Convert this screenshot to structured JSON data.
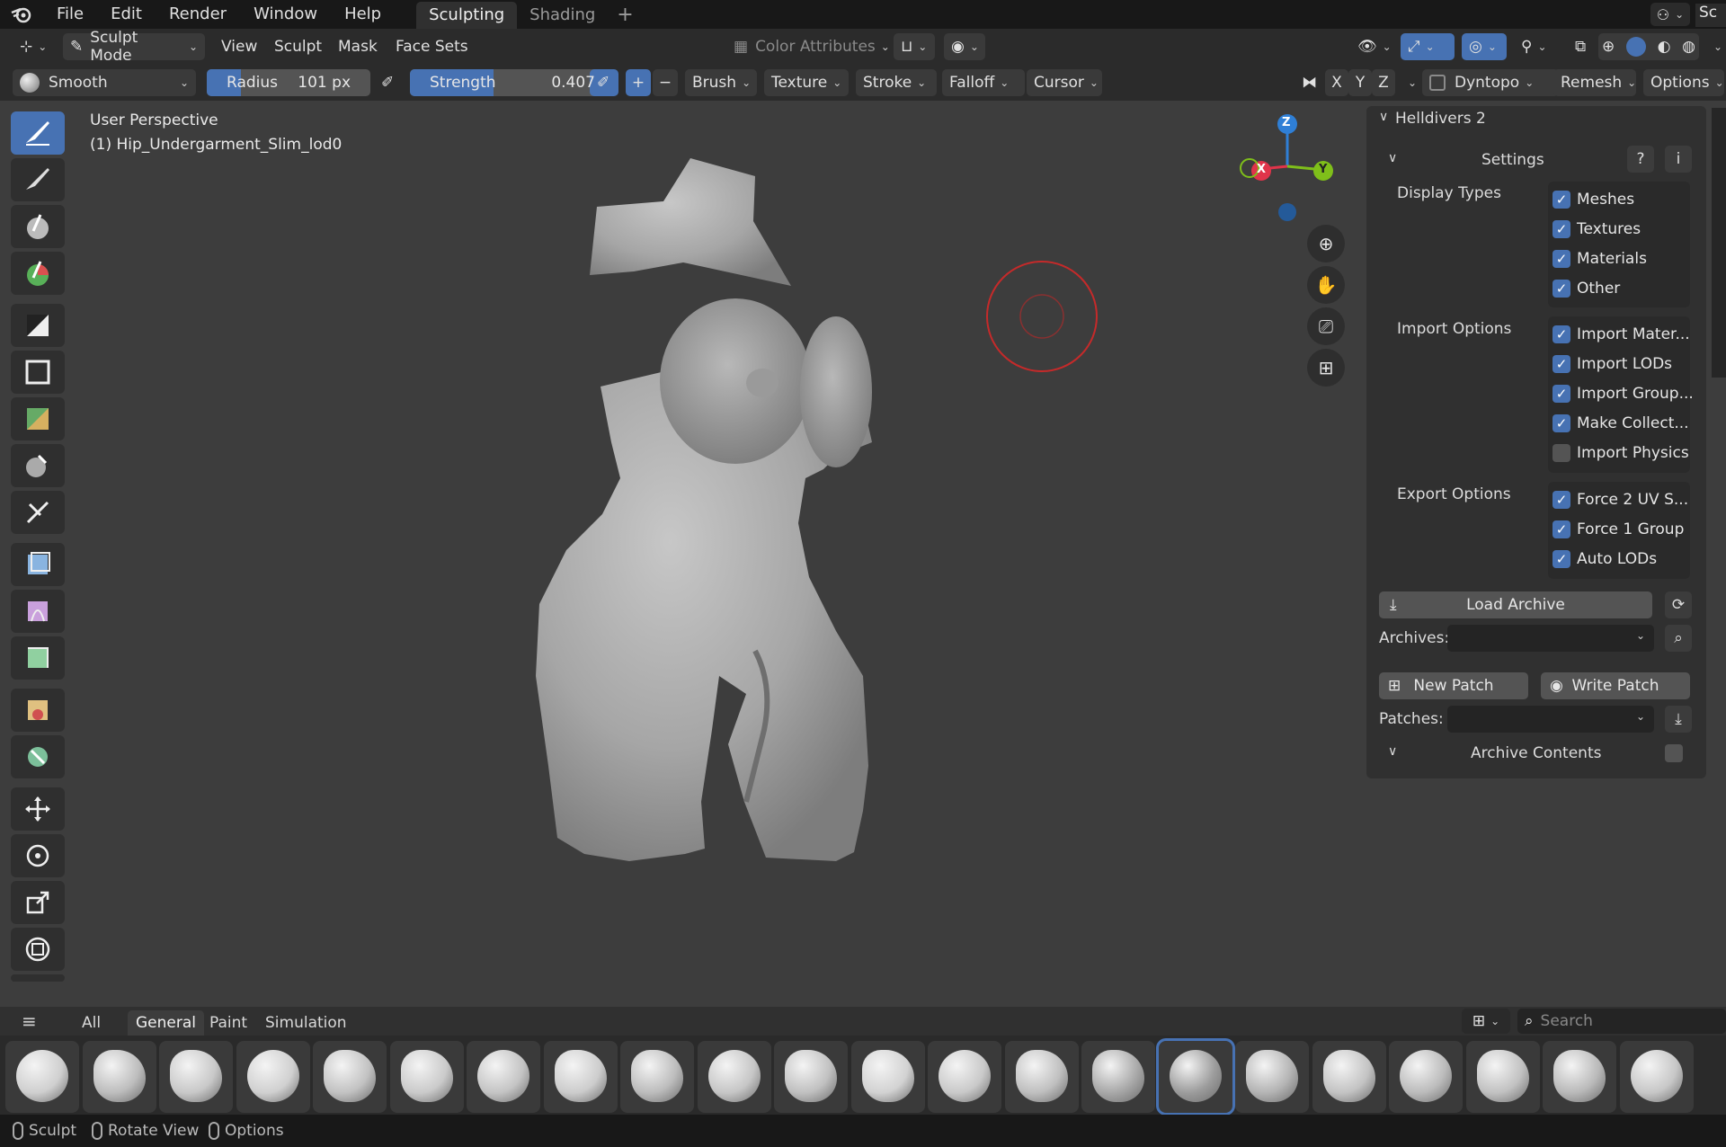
{
  "menu": {
    "items": [
      "File",
      "Edit",
      "Render",
      "Window",
      "Help"
    ],
    "workspace_tabs": [
      {
        "label": "Sculpting",
        "active": true
      },
      {
        "label": "Shading",
        "active": false
      }
    ],
    "add_tab": "+",
    "scene_label": "Sc"
  },
  "header": {
    "mode": "Sculpt Mode",
    "menus": [
      "View",
      "Sculpt",
      "Mask",
      "Face Sets"
    ],
    "color_attributes": "Color Attributes"
  },
  "tool_settings": {
    "brush_name": "Smooth",
    "radius_label": "Radius",
    "radius_value": "101 px",
    "strength_label": "Strength",
    "strength_value": "0.407",
    "strength_fraction": 0.407,
    "plus": "+",
    "minus": "−",
    "dropdowns": [
      "Brush",
      "Texture",
      "Stroke",
      "Falloff",
      "Cursor"
    ],
    "axes": [
      "X",
      "Y",
      "Z"
    ],
    "dyntopo": "Dyntopo",
    "remesh": "Remesh",
    "options": "Options"
  },
  "viewport": {
    "perspective": "User Perspective",
    "object": "(1) Hip_Undergarment_Slim_lod0",
    "gizmo_axes": [
      "Z",
      "X",
      "Y"
    ]
  },
  "npanel": {
    "addon_title": "Helldivers 2",
    "settings_label": "Settings",
    "display_types_label": "Display Types",
    "display_types": [
      {
        "label": "Meshes",
        "checked": true
      },
      {
        "label": "Textures",
        "checked": true
      },
      {
        "label": "Materials",
        "checked": true
      },
      {
        "label": "Other",
        "checked": true
      }
    ],
    "import_options_label": "Import Options",
    "import_options": [
      {
        "label": "Import Mater...",
        "checked": true
      },
      {
        "label": "Import LODs",
        "checked": true
      },
      {
        "label": "Import Group...",
        "checked": true
      },
      {
        "label": "Make Collect...",
        "checked": true
      },
      {
        "label": "Import Physics",
        "checked": false
      }
    ],
    "export_options_label": "Export Options",
    "export_options": [
      {
        "label": "Force 2 UV S...",
        "checked": true
      },
      {
        "label": "Force 1 Group",
        "checked": true
      },
      {
        "label": "Auto LODs",
        "checked": true
      }
    ],
    "load_archive": "Load Archive",
    "archives_label": "Archives:",
    "new_patch": "New Patch",
    "write_patch": "Write Patch",
    "patches_label": "Patches:",
    "archive_contents": "Archive Contents"
  },
  "shelf": {
    "tabs": [
      {
        "label": "All",
        "active": false
      },
      {
        "label": "General",
        "active": true
      },
      {
        "label": "Paint",
        "active": false
      },
      {
        "label": "Simulation",
        "active": false
      }
    ],
    "search_placeholder": "Search",
    "selected_index": 15
  },
  "status": {
    "items": [
      "Sculpt",
      "Rotate View",
      "Options"
    ]
  },
  "colors": {
    "accent": "#4772b3",
    "axis_x": "#e0344a",
    "axis_y": "#7fbf1a",
    "axis_z": "#2f7fd6",
    "brush_cursor": "#c52a2a"
  }
}
